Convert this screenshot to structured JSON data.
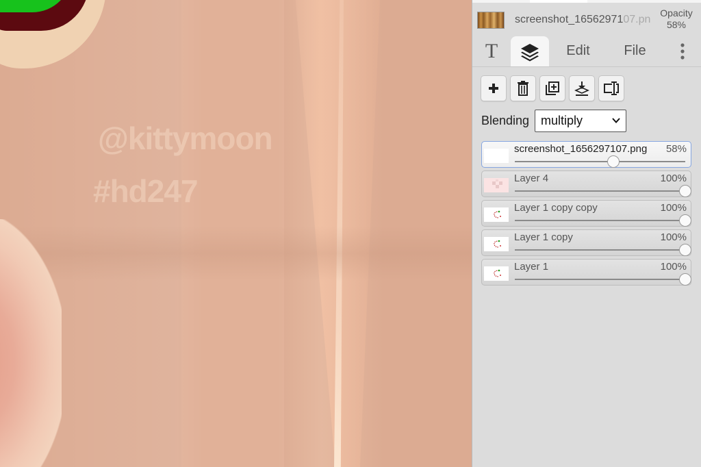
{
  "canvas": {
    "watermark_handle": "@kittymoon",
    "watermark_tag": "#hd247"
  },
  "header": {
    "filename_main": "screenshot_16562971",
    "filename_faded": "07.pn",
    "opacity_label": "Opacity",
    "opacity_value": "58%"
  },
  "tabs": {
    "text_label": "T",
    "edit_label": "Edit",
    "file_label": "File"
  },
  "toolbar": {
    "icons": [
      "add-layer-icon",
      "delete-layer-icon",
      "duplicate-layer-icon",
      "merge-down-icon",
      "rename-layer-icon"
    ]
  },
  "blending": {
    "label": "Blending",
    "selected": "multiply"
  },
  "layers": [
    {
      "name": "screenshot_1656297107.png",
      "opacity_label": "58%",
      "opacity": 0.58,
      "active": true,
      "thumb": "wood"
    },
    {
      "name": "Layer 4",
      "opacity_label": "100%",
      "opacity": 1.0,
      "active": false,
      "thumb": "pinkcheck"
    },
    {
      "name": "Layer 1 copy copy",
      "opacity_label": "100%",
      "opacity": 1.0,
      "active": false,
      "thumb": "sketch"
    },
    {
      "name": "Layer 1 copy",
      "opacity_label": "100%",
      "opacity": 1.0,
      "active": false,
      "thumb": "sketch"
    },
    {
      "name": "Layer 1",
      "opacity_label": "100%",
      "opacity": 1.0,
      "active": false,
      "thumb": "sketch"
    }
  ],
  "colors": {
    "canvas_bg": "#dcab92",
    "panel_bg": "#dcdcdc",
    "active_border": "#86a6e0"
  }
}
